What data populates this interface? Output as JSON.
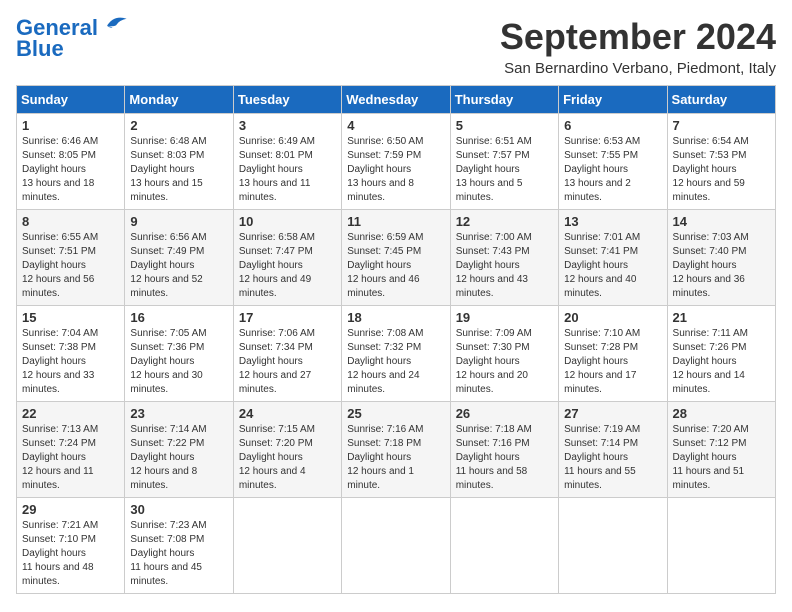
{
  "logo": {
    "line1": "General",
    "line2": "Blue"
  },
  "title": "September 2024",
  "subtitle": "San Bernardino Verbano, Piedmont, Italy",
  "weekdays": [
    "Sunday",
    "Monday",
    "Tuesday",
    "Wednesday",
    "Thursday",
    "Friday",
    "Saturday"
  ],
  "weeks": [
    [
      {
        "day": 1,
        "sunrise": "6:46 AM",
        "sunset": "8:05 PM",
        "daylight": "13 hours and 18 minutes."
      },
      {
        "day": 2,
        "sunrise": "6:48 AM",
        "sunset": "8:03 PM",
        "daylight": "13 hours and 15 minutes."
      },
      {
        "day": 3,
        "sunrise": "6:49 AM",
        "sunset": "8:01 PM",
        "daylight": "13 hours and 11 minutes."
      },
      {
        "day": 4,
        "sunrise": "6:50 AM",
        "sunset": "7:59 PM",
        "daylight": "13 hours and 8 minutes."
      },
      {
        "day": 5,
        "sunrise": "6:51 AM",
        "sunset": "7:57 PM",
        "daylight": "13 hours and 5 minutes."
      },
      {
        "day": 6,
        "sunrise": "6:53 AM",
        "sunset": "7:55 PM",
        "daylight": "13 hours and 2 minutes."
      },
      {
        "day": 7,
        "sunrise": "6:54 AM",
        "sunset": "7:53 PM",
        "daylight": "12 hours and 59 minutes."
      }
    ],
    [
      {
        "day": 8,
        "sunrise": "6:55 AM",
        "sunset": "7:51 PM",
        "daylight": "12 hours and 56 minutes."
      },
      {
        "day": 9,
        "sunrise": "6:56 AM",
        "sunset": "7:49 PM",
        "daylight": "12 hours and 52 minutes."
      },
      {
        "day": 10,
        "sunrise": "6:58 AM",
        "sunset": "7:47 PM",
        "daylight": "12 hours and 49 minutes."
      },
      {
        "day": 11,
        "sunrise": "6:59 AM",
        "sunset": "7:45 PM",
        "daylight": "12 hours and 46 minutes."
      },
      {
        "day": 12,
        "sunrise": "7:00 AM",
        "sunset": "7:43 PM",
        "daylight": "12 hours and 43 minutes."
      },
      {
        "day": 13,
        "sunrise": "7:01 AM",
        "sunset": "7:41 PM",
        "daylight": "12 hours and 40 minutes."
      },
      {
        "day": 14,
        "sunrise": "7:03 AM",
        "sunset": "7:40 PM",
        "daylight": "12 hours and 36 minutes."
      }
    ],
    [
      {
        "day": 15,
        "sunrise": "7:04 AM",
        "sunset": "7:38 PM",
        "daylight": "12 hours and 33 minutes."
      },
      {
        "day": 16,
        "sunrise": "7:05 AM",
        "sunset": "7:36 PM",
        "daylight": "12 hours and 30 minutes."
      },
      {
        "day": 17,
        "sunrise": "7:06 AM",
        "sunset": "7:34 PM",
        "daylight": "12 hours and 27 minutes."
      },
      {
        "day": 18,
        "sunrise": "7:08 AM",
        "sunset": "7:32 PM",
        "daylight": "12 hours and 24 minutes."
      },
      {
        "day": 19,
        "sunrise": "7:09 AM",
        "sunset": "7:30 PM",
        "daylight": "12 hours and 20 minutes."
      },
      {
        "day": 20,
        "sunrise": "7:10 AM",
        "sunset": "7:28 PM",
        "daylight": "12 hours and 17 minutes."
      },
      {
        "day": 21,
        "sunrise": "7:11 AM",
        "sunset": "7:26 PM",
        "daylight": "12 hours and 14 minutes."
      }
    ],
    [
      {
        "day": 22,
        "sunrise": "7:13 AM",
        "sunset": "7:24 PM",
        "daylight": "12 hours and 11 minutes."
      },
      {
        "day": 23,
        "sunrise": "7:14 AM",
        "sunset": "7:22 PM",
        "daylight": "12 hours and 8 minutes."
      },
      {
        "day": 24,
        "sunrise": "7:15 AM",
        "sunset": "7:20 PM",
        "daylight": "12 hours and 4 minutes."
      },
      {
        "day": 25,
        "sunrise": "7:16 AM",
        "sunset": "7:18 PM",
        "daylight": "12 hours and 1 minute."
      },
      {
        "day": 26,
        "sunrise": "7:18 AM",
        "sunset": "7:16 PM",
        "daylight": "11 hours and 58 minutes."
      },
      {
        "day": 27,
        "sunrise": "7:19 AM",
        "sunset": "7:14 PM",
        "daylight": "11 hours and 55 minutes."
      },
      {
        "day": 28,
        "sunrise": "7:20 AM",
        "sunset": "7:12 PM",
        "daylight": "11 hours and 51 minutes."
      }
    ],
    [
      {
        "day": 29,
        "sunrise": "7:21 AM",
        "sunset": "7:10 PM",
        "daylight": "11 hours and 48 minutes."
      },
      {
        "day": 30,
        "sunrise": "7:23 AM",
        "sunset": "7:08 PM",
        "daylight": "11 hours and 45 minutes."
      },
      null,
      null,
      null,
      null,
      null
    ]
  ]
}
